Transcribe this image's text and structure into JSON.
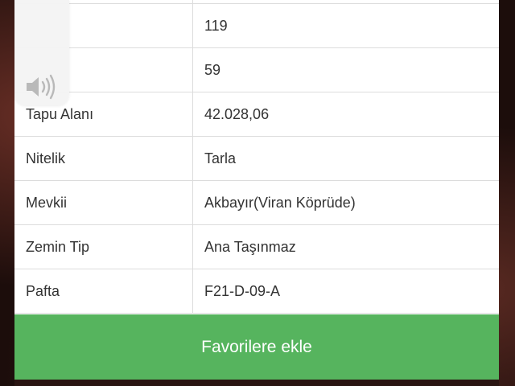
{
  "rows": [
    {
      "label": "",
      "value": ""
    },
    {
      "label": "",
      "value": "119"
    },
    {
      "label": "",
      "value": "59"
    },
    {
      "label": "Tapu Alanı",
      "value": "42.028,06"
    },
    {
      "label": "Nitelik",
      "value": "Tarla"
    },
    {
      "label": "Mevkii",
      "value": "Akbayır(Viran Köprüde)"
    },
    {
      "label": "Zemin Tip",
      "value": "Ana Taşınmaz"
    },
    {
      "label": "Pafta",
      "value": "F21-D-09-A"
    }
  ],
  "favorite_button": {
    "label": "Favorilere ekle"
  },
  "colors": {
    "button_green": "#56b45e",
    "border": "#dcdcdc",
    "text": "#333333"
  },
  "icons": {
    "volume": "speaker-volume-icon"
  }
}
